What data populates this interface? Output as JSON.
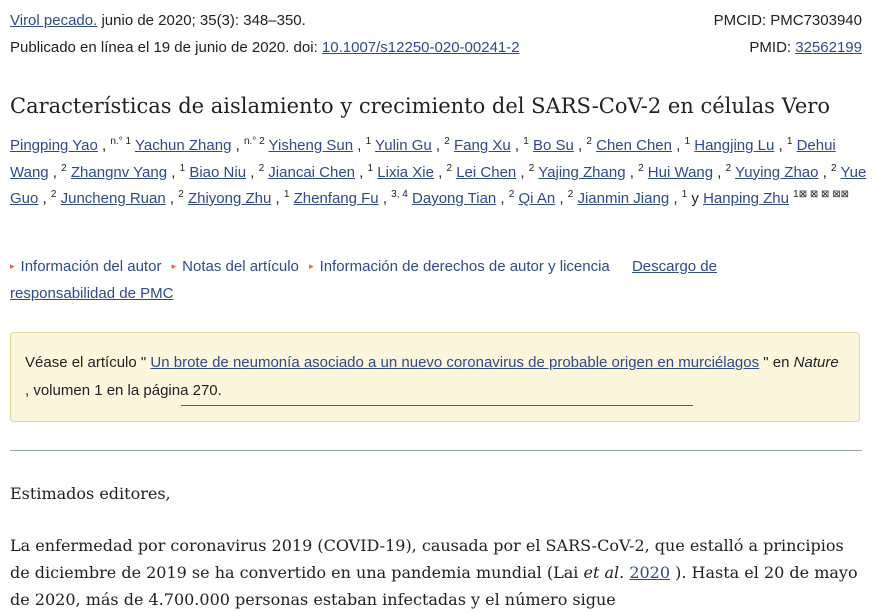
{
  "citation": {
    "journal_link": "Virol pecado.",
    "issue": " junio de 2020; 35(3): 348–350.",
    "pmcid_label": "PMCID: PMC7303940",
    "published_prefix": "Publicado en línea el 19 de junio de 2020. doi: ",
    "doi_link": "10.1007/s12250-020-00241-2",
    "pmid_label": "PMID: ",
    "pmid_link": "32562199"
  },
  "title": "Características de aislamiento y crecimiento del SARS-CoV-2 en células Vero",
  "authors": [
    {
      "name": "Pingping Yao",
      "sep": " , ",
      "sup": "n.° 1"
    },
    {
      "name": "Yachun Zhang",
      "sep": " , ",
      "sup": "n.° 2"
    },
    {
      "name": "Yisheng Sun",
      "sep": " , ",
      "sup": "1"
    },
    {
      "name": "Yulin Gu",
      "sep": " , ",
      "sup": "2"
    },
    {
      "name": "Fang Xu",
      "sep": " , ",
      "sup": "1"
    },
    {
      "name": "Bo Su",
      "sep": " , ",
      "sup": "2"
    },
    {
      "name": "Chen Chen",
      "sep": " , ",
      "sup": "1"
    },
    {
      "name": "Hangjing Lu",
      "sep": " , ",
      "sup": "1"
    },
    {
      "name": "Dehui Wang",
      "sep": " , ",
      "sup": "2"
    },
    {
      "name": "Zhangnv Yang",
      "sep": " , ",
      "sup": "1"
    },
    {
      "name": "Biao Niu",
      "sep": " , ",
      "sup": "2"
    },
    {
      "name": "Jiancai Chen",
      "sep": " , ",
      "sup": "1"
    },
    {
      "name": "Lixia Xie",
      "sep": " , ",
      "sup": "2"
    },
    {
      "name": "Lei Chen",
      "sep": " , ",
      "sup": "2"
    },
    {
      "name": "Yajing Zhang",
      "sep": " , ",
      "sup": "2"
    },
    {
      "name": "Hui Wang",
      "sep": " , ",
      "sup": "2"
    },
    {
      "name": "Yuying Zhao",
      "sep": " , ",
      "sup": "2"
    },
    {
      "name": "Yue Guo",
      "sep": " , ",
      "sup": "2"
    },
    {
      "name": "Juncheng Ruan",
      "sep": " , ",
      "sup": "2"
    },
    {
      "name": "Zhiyong Zhu",
      "sep": " , ",
      "sup": "1"
    },
    {
      "name": "Zhenfang Fu",
      "sep": " , ",
      "sup": "3, 4"
    },
    {
      "name": "Dayong Tian",
      "sep": " , ",
      "sup": "2"
    },
    {
      "name": "Qi An",
      "sep": " , ",
      "sup": "2"
    },
    {
      "name": "Jianmin Jiang",
      "sep": " , ",
      "sup": "1"
    }
  ],
  "authors_conj": " y ",
  "last_author": {
    "name": "Hanping Zhu",
    "sup": "1⊠ ⊠ ⊠ ⊠⊠"
  },
  "info_links": {
    "author_info": "Información del autor",
    "article_notes": "Notas del artículo",
    "copyright": "Información de derechos de autor y licencia",
    "disclaimer": "Descargo de responsabilidad de PMC"
  },
  "notice": {
    "prefix": "Véase el artículo \" ",
    "link": "Un brote de neumonía asociado a un nuevo coronavirus de probable origen en murciélagos",
    "middle": " \" en ",
    "journal": "Nature",
    "suffix": " , volumen 1 en la página 270."
  },
  "body": {
    "greeting": "Estimados editores,",
    "para_start": "La enfermedad por coronavirus 2019 (COVID-19), causada por el SARS-CoV-2, que estalló a principios de diciembre de 2019 se ha convertido en una pandemia mundial (Lai ",
    "para_etal": "et al.",
    "para_space": " ",
    "para_ref": "2020",
    "para_end": " ). Hasta el 20 de mayo de 2020, más de 4.700.000 personas estaban infectadas y el número sigue"
  },
  "colors": {
    "link": "#2f4a8a",
    "accent_caret": "#d9622b",
    "notice_bg": "#fcf6dc",
    "notice_border": "#e3d59c"
  }
}
